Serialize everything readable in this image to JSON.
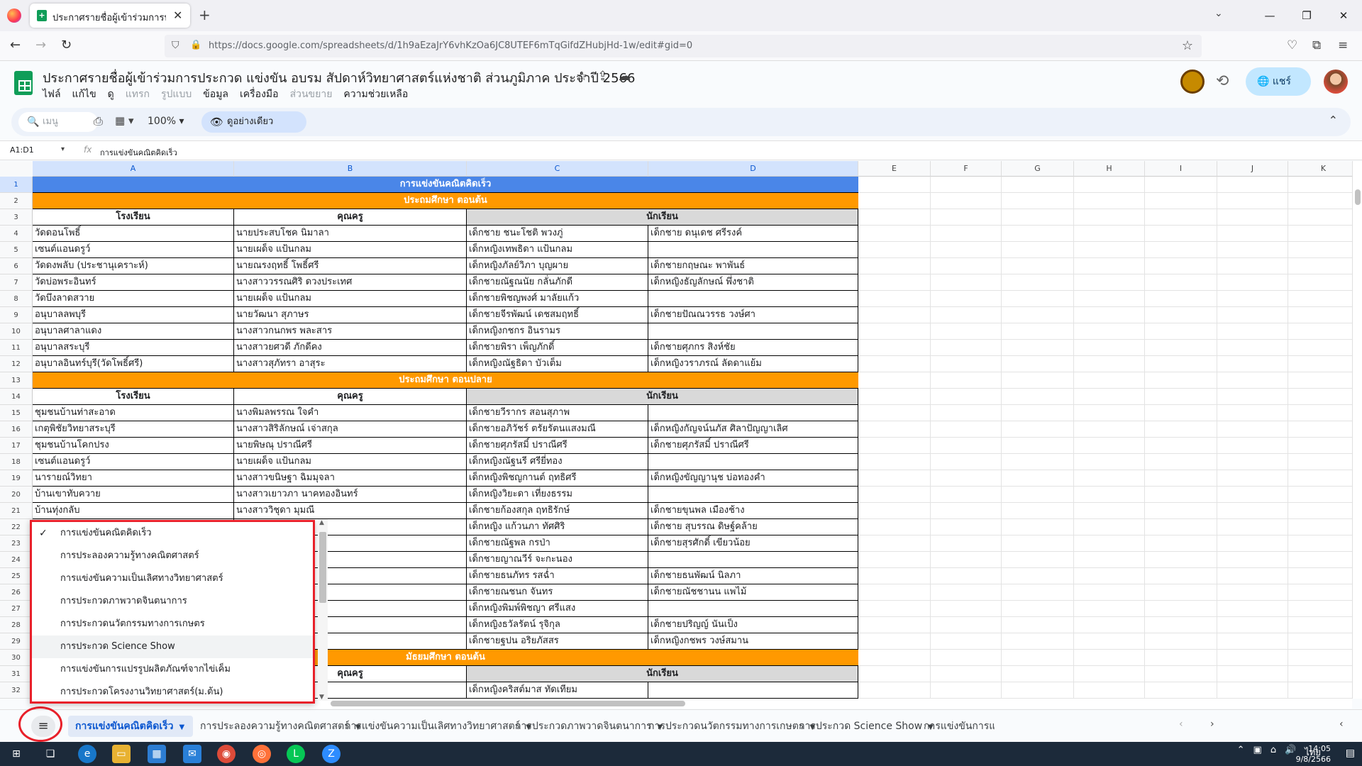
{
  "browser": {
    "tab_title": "ประกาศรายชื่อผู้เข้าร่วมการประกวด",
    "url": "https://docs.google.com/spreadsheets/d/1h9aEzaJrY6vhKzOa6JC8UTEF6mTqGifdZHubjHd-1w/edit#gid=0"
  },
  "sheets": {
    "doc_title": "ประกาศรายชื่อผู้เข้าร่วมการประกวด แข่งขัน อบรม สัปดาห์วิทยาศาสตร์แห่งชาติ ส่วนภูมิภาค ประจำปี 2566",
    "menu": [
      "ไฟล์",
      "แก้ไข",
      "ดู",
      "แทรก",
      "รูปแบบ",
      "ข้อมูล",
      "เครื่องมือ",
      "ส่วนขยาย",
      "ความช่วยเหลือ"
    ],
    "share_label": "แชร์",
    "toolbar": {
      "search_placeholder": "เมนู",
      "zoom": "100%",
      "view_only": "ดูอย่างเดียว"
    },
    "namebox": "A1:D1",
    "formula": "การแข่งขันคณิตคิดเร็ว"
  },
  "columns": [
    "A",
    "B",
    "C",
    "D",
    "E",
    "F",
    "G",
    "H",
    "I",
    "J",
    "K"
  ],
  "rows": [
    {
      "n": "1",
      "type": "title",
      "text": "การแข่งขันคณิตคิดเร็ว"
    },
    {
      "n": "2",
      "type": "section",
      "text": "ประถมศึกษา ตอนต้น"
    },
    {
      "n": "3",
      "type": "header",
      "school": "โรงเรียน",
      "teacher": "คุณครู",
      "students": "นักเรียน"
    },
    {
      "n": "4",
      "type": "data",
      "a": "วัดดอนโพธิ์",
      "b": "นายประสบโชค นิมาลา",
      "c": "เด็กชาย ชนะโชติ  พวงภู่",
      "d": "เด็กชาย ดนุเดช  ศรีรงค์"
    },
    {
      "n": "5",
      "type": "data",
      "a": "เซนต์แอนดรูว์",
      "b": "นายเผด็จ แป้นกลม",
      "c": "เด็กหญิงเทพธิดา แป้นกลม",
      "d": ""
    },
    {
      "n": "6",
      "type": "data",
      "a": "วัดดงพลับ (ประชานุเคราะห์)",
      "b": "นายณรงฤทธิ์ โพธิ์ศรี",
      "c": "เด็กหญิงภัลย์วิภา บุญผาย",
      "d": "เด็กชายกฤษณะ พาพันธ์"
    },
    {
      "n": "7",
      "type": "data",
      "a": "วัดบ่อพระอินทร์",
      "b": "นางสาววรรณศิริ ดวงประเทศ",
      "c": "เด็กชายณัฐณนัย กลั่นภักดี",
      "d": "เด็กหญิงธัญลักษณ์ พึ่งชาติ"
    },
    {
      "n": "8",
      "type": "data",
      "a": "วัดบึงลาดสวาย",
      "b": "นายเผด็จ แป้นกลม",
      "c": "เด็กชายพิชญพงศ์ มาลัยแก้ว",
      "d": ""
    },
    {
      "n": "9",
      "type": "data",
      "a": "อนุบาลลพบุรี",
      "b": "นายวัฒนา สุภาษร",
      "c": "เด็กชายจีรพัฒน์ เดชสมฤทธิ์",
      "d": "เด็กชายปัณณวรรธ วงษ์ศา"
    },
    {
      "n": "10",
      "type": "data",
      "a": "อนุบาลศาลาแดง",
      "b": "นางสาวกนกพร พละสาร",
      "c": "เด็กหญิงกชกร อินรามร",
      "d": ""
    },
    {
      "n": "11",
      "type": "data",
      "a": "อนุบาลสระบุรี",
      "b": "นางสาวยศวดี ภักดีคง",
      "c": "เด็กชายพิรา เพ็ญภักดิ์",
      "d": "เด็กชายศุภกร สิงห์ชัย"
    },
    {
      "n": "12",
      "type": "data",
      "a": "อนุบาลอินทร์บุรี(วัดโพธิ์ศรี)",
      "b": "นางสาวสุภัทรา อาสุระ",
      "c": "เด็กหญิงณัฐธิดา บัวเต็ม",
      "d": "เด็กหญิงวราภรณ์ ลัดดาแย้ม"
    },
    {
      "n": "13",
      "type": "section",
      "text": "ประถมศึกษา ตอนปลาย"
    },
    {
      "n": "14",
      "type": "header",
      "school": "โรงเรียน",
      "teacher": "คุณครู",
      "students": "นักเรียน"
    },
    {
      "n": "15",
      "type": "data",
      "a": "ชุมชนบ้านท่าสะอาด",
      "b": "นางพิมลพรรณ ใจคำ",
      "c": "เด็กชายวีรากร สอนสุภาพ",
      "d": ""
    },
    {
      "n": "16",
      "type": "data",
      "a": "เกตุพิชัยวิทยาสระบุรี",
      "b": "นางสาวสิริลักษณ์ เจ่าสกุล",
      "c": "เด็กชายอภิวัชร์ ตรัยรัตนแสงมณี",
      "d": "เด็กหญิงกัญจน์นภัส ศิลาปัญญาเลิศ"
    },
    {
      "n": "17",
      "type": "data",
      "a": "ชุมชนบ้านโคกปรง",
      "b": "นายพิษณุ ปราณีศรี",
      "c": "เด็กชายศุภรัสมิ์ ปราณีศรี",
      "d": "เด็กชายศุภรัสมิ์ ปราณีศรี"
    },
    {
      "n": "18",
      "type": "data",
      "a": "เซนต์แอนดรูว์",
      "b": "นายเผด็จ แป้นกลม",
      "c": "เด็กหญิงณัฐนรี ศรียี่ทอง",
      "d": ""
    },
    {
      "n": "19",
      "type": "data",
      "a": "นารายณ์วิทยา",
      "b": "นางสาวขนิษฐา ฉิมมุจลา",
      "c": "เด็กหญิงพิชญกานต์ ฤทธิศรี",
      "d": "เด็กหญิงขัญญานุช บ่อทองคำ"
    },
    {
      "n": "20",
      "type": "data",
      "a": "บ้านเขาทับควาย",
      "b": "นางสาวเยาวภา นาคทองอินทร์",
      "c": "เด็กหญิงวิยะดา เที่ยงธรรม",
      "d": ""
    },
    {
      "n": "21",
      "type": "data",
      "a": "บ้านทุ่งกลับ",
      "b": "นางสาววิชุดา มุมณี",
      "c": "เด็กชายก้องสกุล ฤทธิรักษ์",
      "d": "เด็กชายขุนพล เมืองช้าง"
    },
    {
      "n": "22",
      "type": "data",
      "a": "",
      "b": "",
      "c": "เด็กหญิง แก้วนภา  ทัศศิริ",
      "d": "เด็กชาย สุบรรณ  ดิษฐ์คล้าย"
    },
    {
      "n": "23",
      "type": "data",
      "a": "",
      "b": "ษ์",
      "c": "เด็กชายณัฐพล กรป่า",
      "d": "เด็กชายสุรศักดิ์ เขียวน้อย"
    },
    {
      "n": "24",
      "type": "data",
      "a": "",
      "b": "",
      "c": "เด็กชายญาณวีร์ จะกะนอง",
      "d": ""
    },
    {
      "n": "25",
      "type": "data",
      "a": "",
      "b": "",
      "c": "เด็กชายธนภัทร รสฉ่ำ",
      "d": "เด็กชายธนพัฒน์ นิลภา"
    },
    {
      "n": "26",
      "type": "data",
      "a": "",
      "b": "ญวารี",
      "c": "เด็กชายณชนก จันทร",
      "d": "เด็กชายณัชชานน แพไม้"
    },
    {
      "n": "27",
      "type": "data",
      "a": "",
      "b": "",
      "c": "เด็กหญิงพิมพ์พิชญา ศรีแสง",
      "d": ""
    },
    {
      "n": "28",
      "type": "data",
      "a": "",
      "b": "",
      "c": "เด็กหญิงธวัลรัตน์ รุจิกุล",
      "d": "เด็กชายปริญญ์ นันเป็ง"
    },
    {
      "n": "29",
      "type": "data",
      "a": "",
      "b": "",
      "c": "เด็กชายฐปน อริยภัสสร",
      "d": "เด็กหญิงกชพร วงษ์สมาน"
    },
    {
      "n": "30",
      "type": "section",
      "text": "มัธยมศึกษา ตอนต้น"
    },
    {
      "n": "31",
      "type": "header",
      "school": "",
      "teacher": "คุณครู",
      "students": "นักเรียน"
    },
    {
      "n": "32",
      "type": "data",
      "a": "",
      "b": "",
      "c": "เด็กหญิงคริสต์มาส ทัดเทียม",
      "d": ""
    }
  ],
  "sheet_tabs": [
    "การแข่งขันคณิตคิดเร็ว",
    "การประลองความรู้ทางคณิตศาสตร์",
    "การแข่งขันความเป็นเลิศทางวิทยาศาสตร์",
    "การประกวดภาพวาดจินตนาการ",
    "การประกวดนวัตกรรมทางการเกษตร",
    "การประกวด Science Show",
    "การแข่งขันการแ"
  ],
  "popup_items": [
    "การแข่งขันคณิตคิดเร็ว",
    "การประลองความรู้ทางคณิตศาสตร์",
    "การแข่งขันความเป็นเลิศทางวิทยาศาสตร์",
    "การประกวดภาพวาดจินตนาการ",
    "การประกวดนวัตกรรมทางการเกษตร",
    "การประกวด Science Show",
    "การแข่งขันการแปรรูปผลิตภัณฑ์จากไข่เค็ม",
    "การประกวดโครงงานวิทยาศาสตร์(ม.ต้น)"
  ],
  "taskbar": {
    "lang": "ไทย",
    "time": "14:05",
    "date": "9/8/2566"
  },
  "colors": {
    "title_band": "#4a86e8",
    "section_band": "#ff9900",
    "header_band": "#d9d9d9",
    "accent": "#0b57d0"
  }
}
